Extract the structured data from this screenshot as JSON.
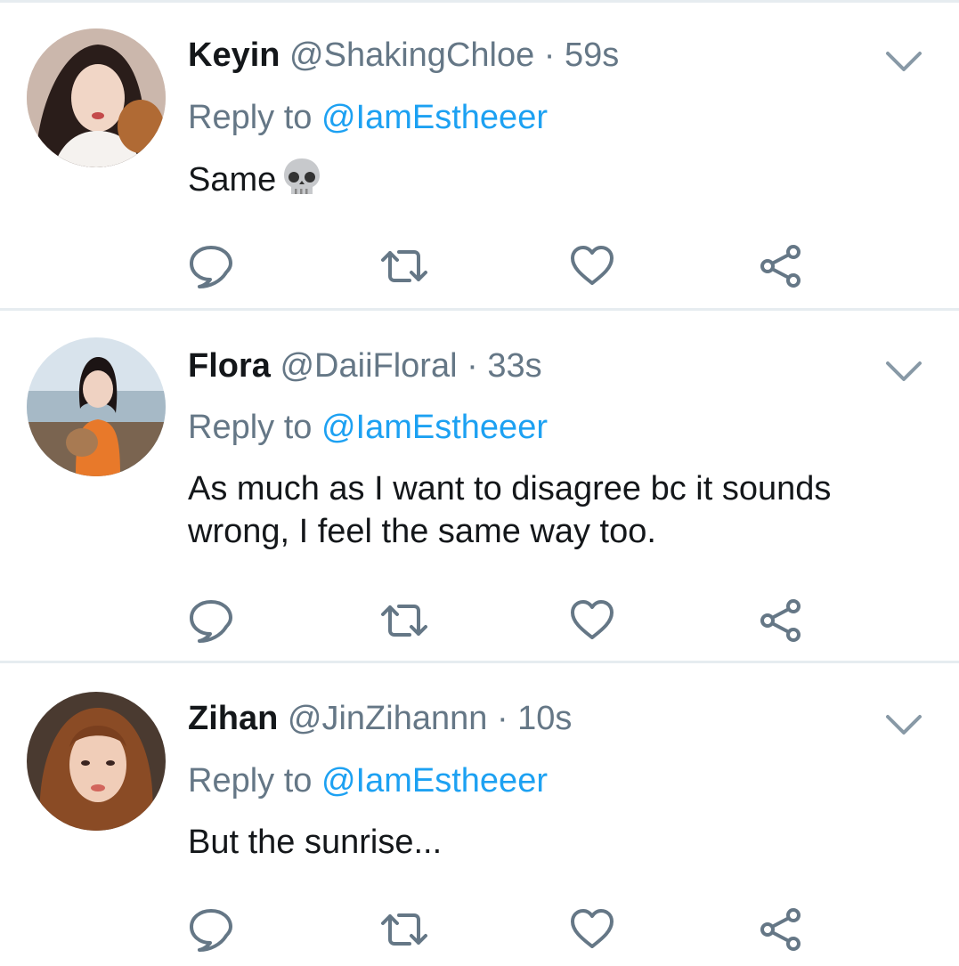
{
  "tweets": [
    {
      "name": "Keyin",
      "handle": "@ShakingChloe",
      "separator": "·",
      "time": "59s",
      "reply_prefix": "Reply to",
      "reply_to": "@IamEstheeer",
      "text": "Same",
      "emoji": "skull-emoji"
    },
    {
      "name": "Flora",
      "handle": "@DaiiFloral",
      "separator": "·",
      "time": "33s",
      "reply_prefix": "Reply to",
      "reply_to": "@IamEstheeer",
      "text": "As much as I want to disagree bc it sounds wrong, I feel the same way too."
    },
    {
      "name": "Zihan",
      "handle": "@JinZihannn",
      "separator": "·",
      "time": "10s",
      "reply_prefix": "Reply to",
      "reply_to": "@IamEstheeer",
      "text": "But the sunrise..."
    }
  ],
  "icons": {
    "reply": "reply-bubble-icon",
    "retweet": "retweet-icon",
    "like": "heart-icon",
    "share": "share-icon",
    "more": "chevron-down-icon"
  },
  "colors": {
    "link": "#1da1f2",
    "secondary": "#657786",
    "primary_text": "#14171a",
    "divider": "#e6ecf0"
  }
}
